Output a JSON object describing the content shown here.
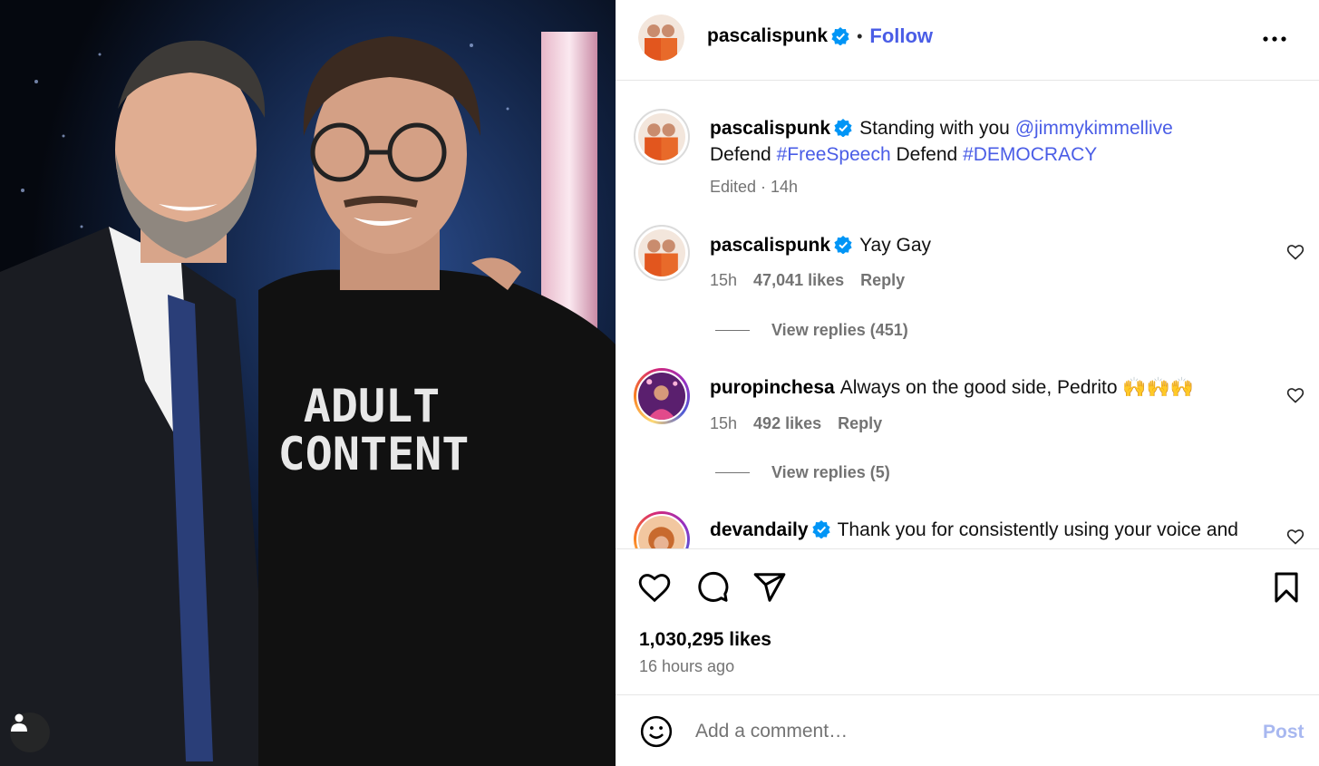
{
  "post": {
    "username": "pascalispunk",
    "follow_label": "Follow",
    "separator": "•"
  },
  "caption": {
    "username": "pascalispunk",
    "text_part1": "Standing with you",
    "mention": "@jimmykimmellive",
    "text_defend1": "Defend",
    "hashtag1": "#FreeSpeech",
    "text_defend2": "Defend",
    "hashtag2": "#DEMOCRACY",
    "meta": "Edited · 14h"
  },
  "comments": [
    {
      "username": "pascalispunk",
      "text": "Yay Gay",
      "time": "15h",
      "likes": "47,041 likes",
      "reply": "Reply",
      "view_replies": "View replies (451)"
    },
    {
      "username": "puropinchesa",
      "text": "Always on the good side, Pedrito 🙌🙌🙌",
      "time": "15h",
      "likes": "492 likes",
      "reply": "Reply",
      "view_replies": "View replies (5)"
    },
    {
      "username": "devandaily",
      "text": "Thank you for consistently using your voice and"
    }
  ],
  "photo": {
    "shirt_line1": "ADULT",
    "shirt_line2": "CONTENT"
  },
  "stats": {
    "likes": "1,030,295 likes",
    "time_ago": "16 hours ago"
  },
  "add_comment": {
    "placeholder": "Add a comment…",
    "post_label": "Post"
  },
  "icons": {
    "verified": "verified-badge-icon",
    "more": "more-options-icon",
    "like": "heart-icon",
    "comment": "comment-bubble-icon",
    "share": "paper-plane-icon",
    "save": "bookmark-icon",
    "emoji": "emoji-smiley-icon",
    "tag": "person-tag-icon"
  },
  "colors": {
    "link": "#4a5de6",
    "verified": "#0095f6",
    "muted": "#737373"
  }
}
